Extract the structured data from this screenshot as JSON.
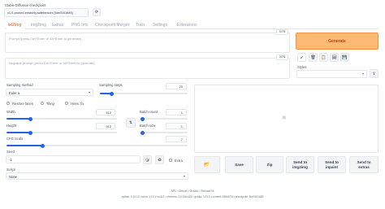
{
  "checkpoint": {
    "label": "Stable Diffusion checkpoint",
    "value": "v1-5-pruned-emaonly.safetensors [6ce0161689]"
  },
  "tabs": [
    "txt2img",
    "img2img",
    "Extras",
    "PNG Info",
    "Checkpoint Merger",
    "Train",
    "Settings",
    "Extensions"
  ],
  "prompt": {
    "placeholder": "Prompt (press Ctrl+Enter or Alt+Enter to generate)",
    "counter": "0/75"
  },
  "negative_prompt": {
    "placeholder": "Negative prompt (press Ctrl+Enter or Alt+Enter to generate)",
    "counter": "0/75"
  },
  "generate_label": "Generate",
  "styles_label": "Styles",
  "sampling": {
    "method_label": "Sampling method",
    "method_value": "Euler a",
    "steps_label": "Sampling steps",
    "steps_value": "20",
    "steps_fraction": 0.13
  },
  "checks": {
    "restore_faces": "Restore faces",
    "tiling": "Tiling",
    "hires_fix": "Hires. fix"
  },
  "width": {
    "label": "Width",
    "value": "512",
    "fraction": 0.22
  },
  "height": {
    "label": "Height",
    "value": "512",
    "fraction": 0.22
  },
  "batch_count": {
    "label": "Batch count",
    "value": "1",
    "fraction": 0.0
  },
  "batch_size": {
    "label": "Batch size",
    "value": "1",
    "fraction": 0.0
  },
  "cfg": {
    "label": "CFG Scale",
    "value": "7",
    "fraction": 0.2
  },
  "seed": {
    "label": "Seed",
    "value": "-1",
    "extra_label": "Extra"
  },
  "script": {
    "label": "Script",
    "value": "None"
  },
  "output_buttons": {
    "save": "Save",
    "zip": "Zip",
    "send_img2img": "Send to img2img",
    "send_inpaint": "Send to inpaint",
    "send_extras": "Send to extras"
  },
  "footer": {
    "links": [
      "API",
      "Github",
      "Gradio",
      "Reload UI"
    ],
    "info": "python: 3.10.10  •  torch: 1.13.1+cu117  •  xformers: 0.0.16rc425  •  gradio: 3.23.0  •  commit: 955df775  •  checkpoint: 6ce0161689"
  },
  "colors": {
    "accent": "#ea580c",
    "generate_bg": "#fdba74",
    "slider": "#2563eb"
  }
}
